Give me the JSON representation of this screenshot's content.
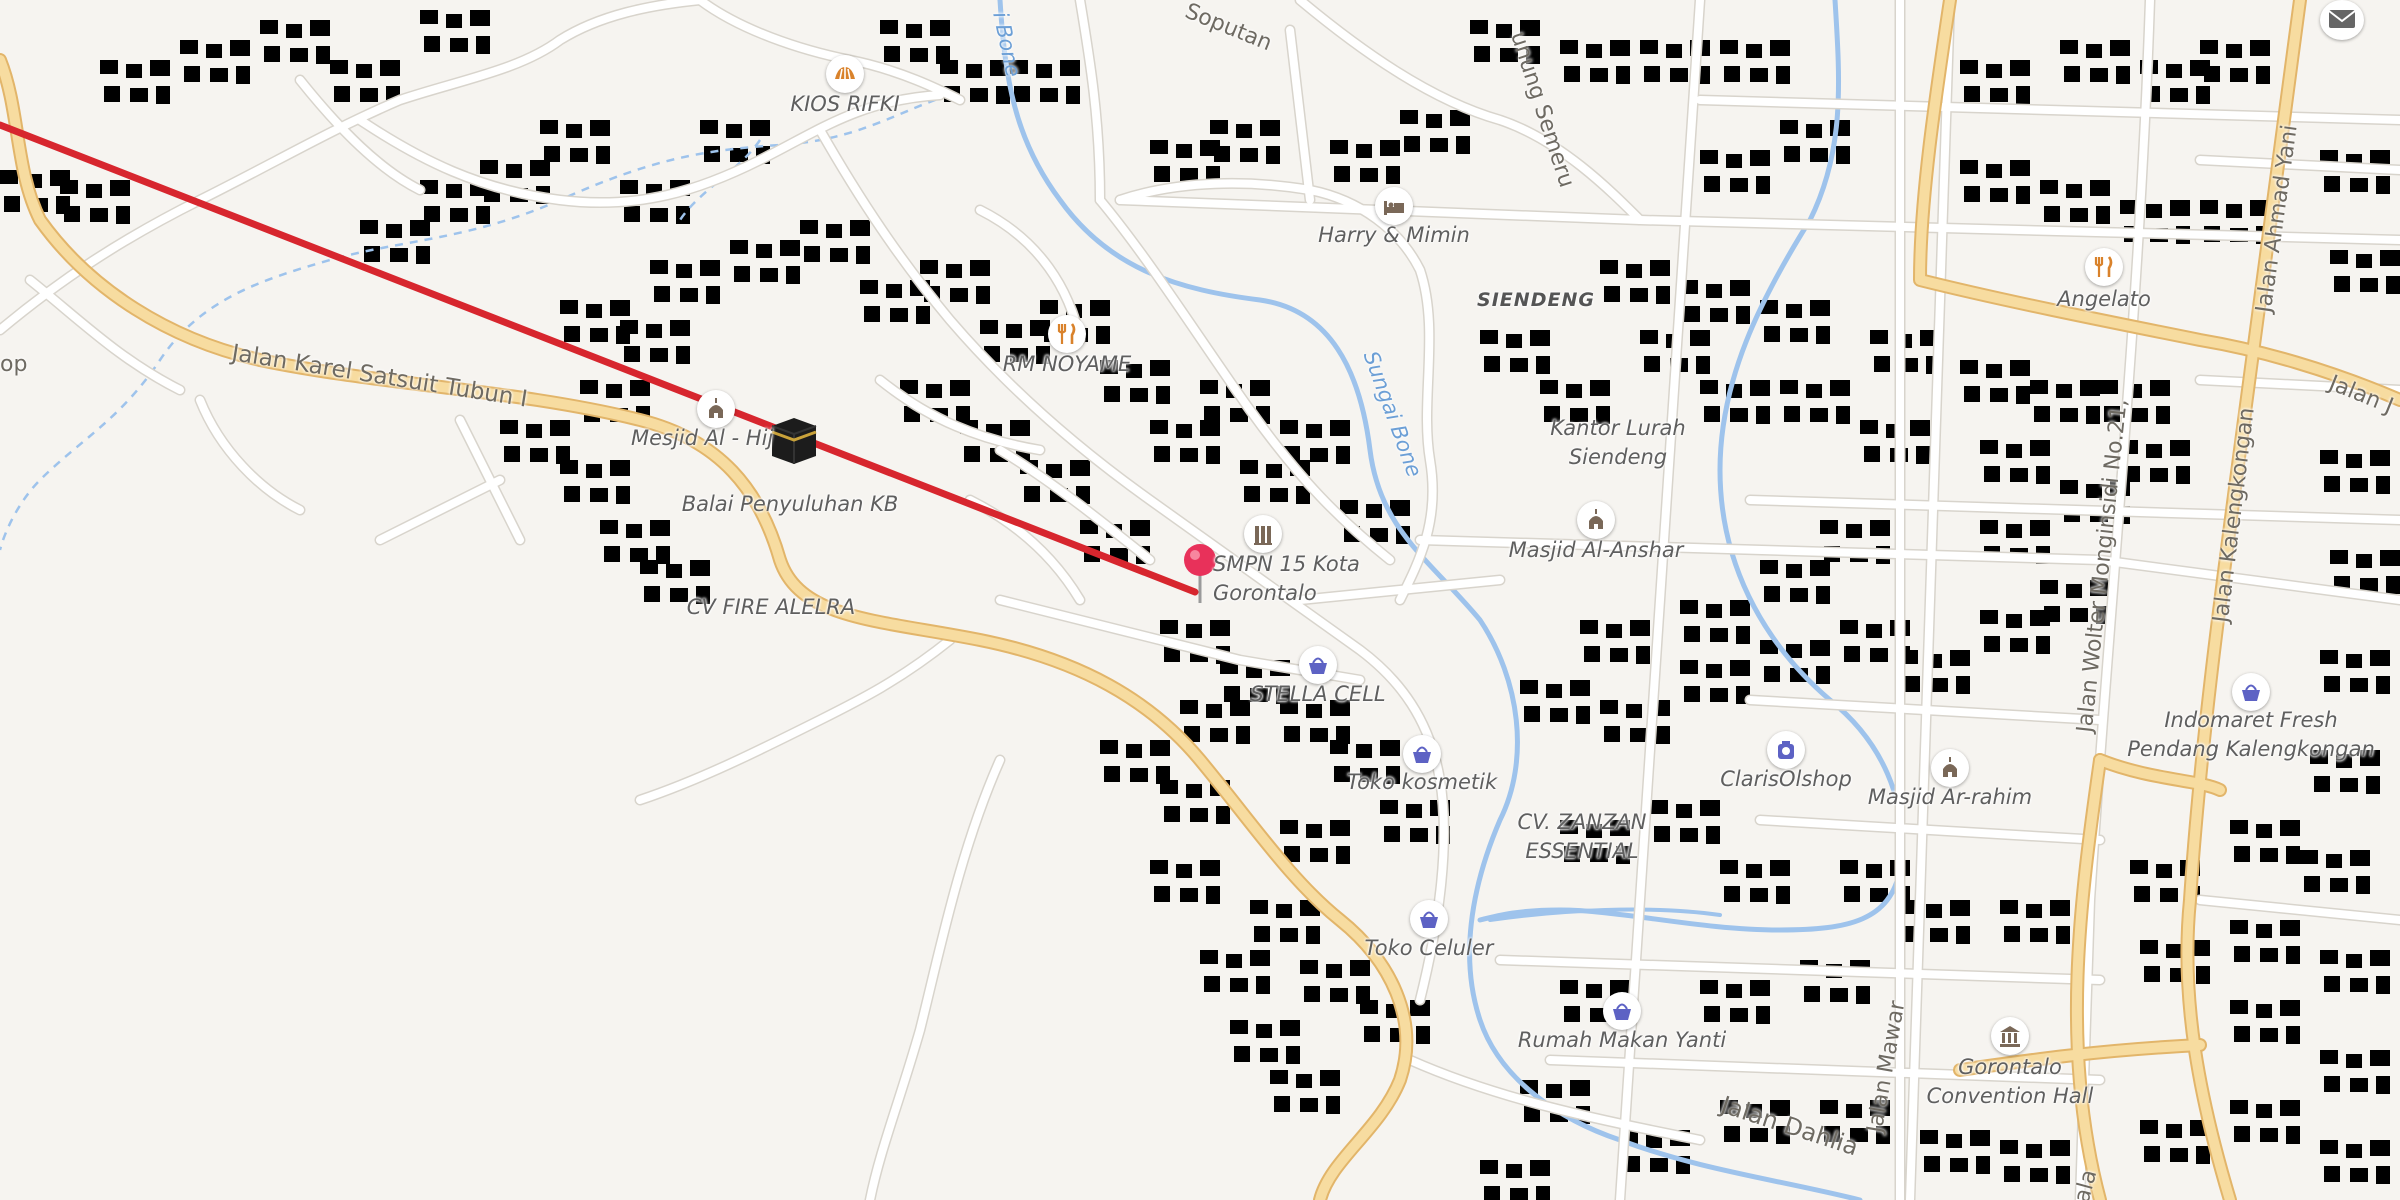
{
  "map": {
    "colors": {
      "background": "#f6f4f0",
      "major_road": "#f7dca0",
      "major_road_casing": "#e2b56a",
      "minor_road": "#ffffff",
      "minor_road_casing": "#d8d4cc",
      "building": "#e8e3dc",
      "water": "#9ec3ec",
      "route": "#d7262e",
      "pin": "#e8315a",
      "poi_food": "#d9822b",
      "poi_shop": "#5d62c4",
      "poi_worship": "#7a6858"
    },
    "route_visible": true,
    "selected_location": "SMPN 15 Kota Gorontalo",
    "roads": {
      "karel": "Jalan Karel Satsuit Tubun I",
      "soputan": "Soputan",
      "semeru": "unung Semeru",
      "monginsidi": "Jalan Wolter Monginsidi No.21,",
      "kalengkongan": "Jalan Kalengkongan",
      "ahmad_yani": "Jalan Ahmad Yani",
      "dahlia": "Jalan Dahlia",
      "mawar": "Jalan Mawar",
      "jalan_j": "Jalan J",
      "jala": "Jala",
      "op": "op"
    },
    "water": {
      "bone_top": "i Bone",
      "bone_mid": "Sungai Bone"
    },
    "places": {
      "kios_rifki": "KIOS RIFKI",
      "harry_mimin": "Harry & Mimin",
      "siendeng": "SIENDENG",
      "angelato": "Angelato",
      "rm_noyame": "RM NOYAME",
      "kantor_lurah_1": "Kantor Lurah",
      "kantor_lurah_2": "Siendeng",
      "mesjid_al_hijrah": "Mesjid Al - Hij",
      "balai": "Balai Penyuluhan KB",
      "masjid_al_anshar": "Masjid Al-Anshar",
      "smpn_1": "SMPN 15 Kota",
      "smpn_2": "Gorontalo",
      "cv_fire": "CV FIRE ALELRA",
      "stella": "STELLA CELL",
      "indomaret_1": "Indomaret Fresh",
      "indomaret_2": "Pendang Kalengkongan",
      "claris": "ClarisOlshop",
      "masjid_ar_rahim": "Masjid Ar-rahim",
      "toko_kosmetik": "Toko kosmetik",
      "zanzan_1": "CV. ZANZAN",
      "zanzan_2": "ESSENTIAL",
      "toko_celuler": "Toko Celuler",
      "rumah_makan": "Rumah Makan Yanti",
      "convention_1": "Gorontalo",
      "convention_2": "Convention Hall"
    },
    "icons": {
      "kios_rifki": "bakery-icon",
      "harry_mimin": "hotel-bed-icon",
      "angelato": "restaurant-icon",
      "rm_noyame": "restaurant-icon",
      "mesjid": "mosque-icon",
      "masjid_al_anshar": "mosque-icon",
      "smpn": "school-icon",
      "stella": "shop-basket-icon",
      "indomaret": "shop-basket-icon",
      "claris": "camera-shop-icon",
      "masjid_ar_rahim": "mosque-icon",
      "toko_kosmetik": "shop-basket-icon",
      "toko_celuler": "shop-basket-icon",
      "rumah_makan": "shop-basket-icon",
      "convention": "museum-icon",
      "kaaba": "kaaba-icon",
      "pin": "location-pin-icon",
      "mail": "mail-icon"
    }
  }
}
